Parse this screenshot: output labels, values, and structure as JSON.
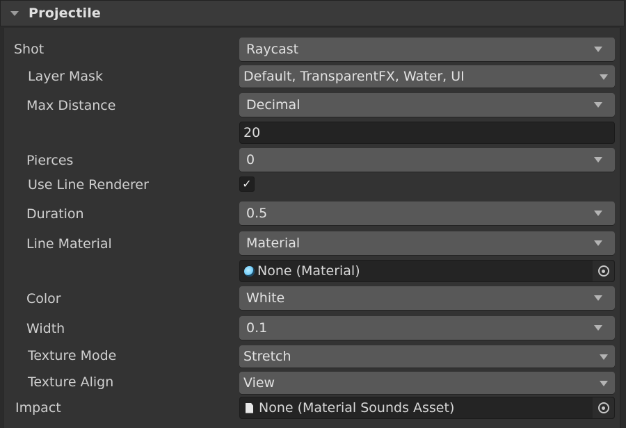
{
  "section": {
    "title": "Projectile",
    "expanded": true
  },
  "fields": {
    "shot": {
      "label": "Shot",
      "value": "Raycast"
    },
    "layer_mask": {
      "label": "Layer Mask",
      "value": "Default, TransparentFX, Water, UI"
    },
    "max_distance": {
      "label": "Max Distance",
      "mode": "Decimal",
      "value": "20"
    },
    "pierces": {
      "label": "Pierces",
      "value": "0"
    },
    "use_line_renderer": {
      "label": "Use Line Renderer",
      "checked": true,
      "check_glyph": "✓"
    },
    "duration": {
      "label": "Duration",
      "value": "0.5"
    },
    "line_material": {
      "label": "Line Material",
      "mode": "Material",
      "object_value": "None (Material)"
    },
    "color": {
      "label": "Color",
      "value": "White"
    },
    "width": {
      "label": "Width",
      "value": "0.1"
    },
    "texture_mode": {
      "label": "Texture Mode",
      "value": "Stretch"
    },
    "texture_align": {
      "label": "Texture Align",
      "value": "View"
    },
    "impact": {
      "label": "Impact",
      "object_value": "None (Material Sounds Asset)"
    }
  }
}
